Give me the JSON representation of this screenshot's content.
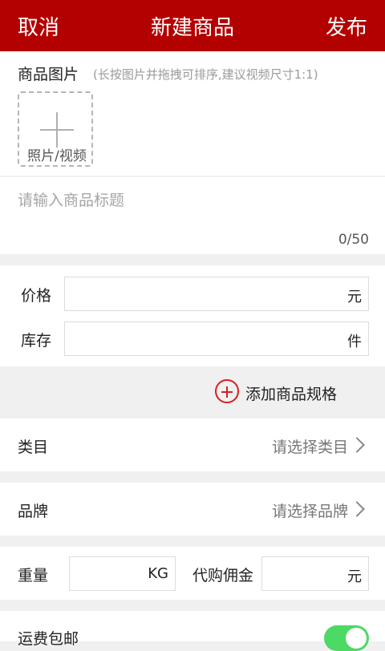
{
  "header": {
    "cancel": "取消",
    "title": "新建商品",
    "publish": "发布"
  },
  "photos": {
    "title": "商品图片",
    "hint": "(长按图片并拖拽可排序,建议视频尺寸1:1)",
    "add_label": "照片/视频"
  },
  "product_title": {
    "placeholder": "请输入商品标题",
    "counter": "0/50"
  },
  "price": {
    "label": "价格",
    "unit": "元",
    "value": ""
  },
  "stock": {
    "label": "库存",
    "unit": "件",
    "value": ""
  },
  "spec": {
    "add_label": "添加商品规格"
  },
  "category": {
    "label": "类目",
    "placeholder": "请选择类目"
  },
  "brand": {
    "label": "品牌",
    "placeholder": "请选择品牌"
  },
  "weight": {
    "label": "重量",
    "unit": "KG",
    "value": ""
  },
  "commission": {
    "label": "代购佣金",
    "unit": "元",
    "value": ""
  },
  "free_shipping": {
    "label": "运费包邮",
    "enabled": true,
    "accent": "#4cd964"
  },
  "colors": {
    "brand_red": "#b30000",
    "add_icon_red": "#d62020"
  }
}
